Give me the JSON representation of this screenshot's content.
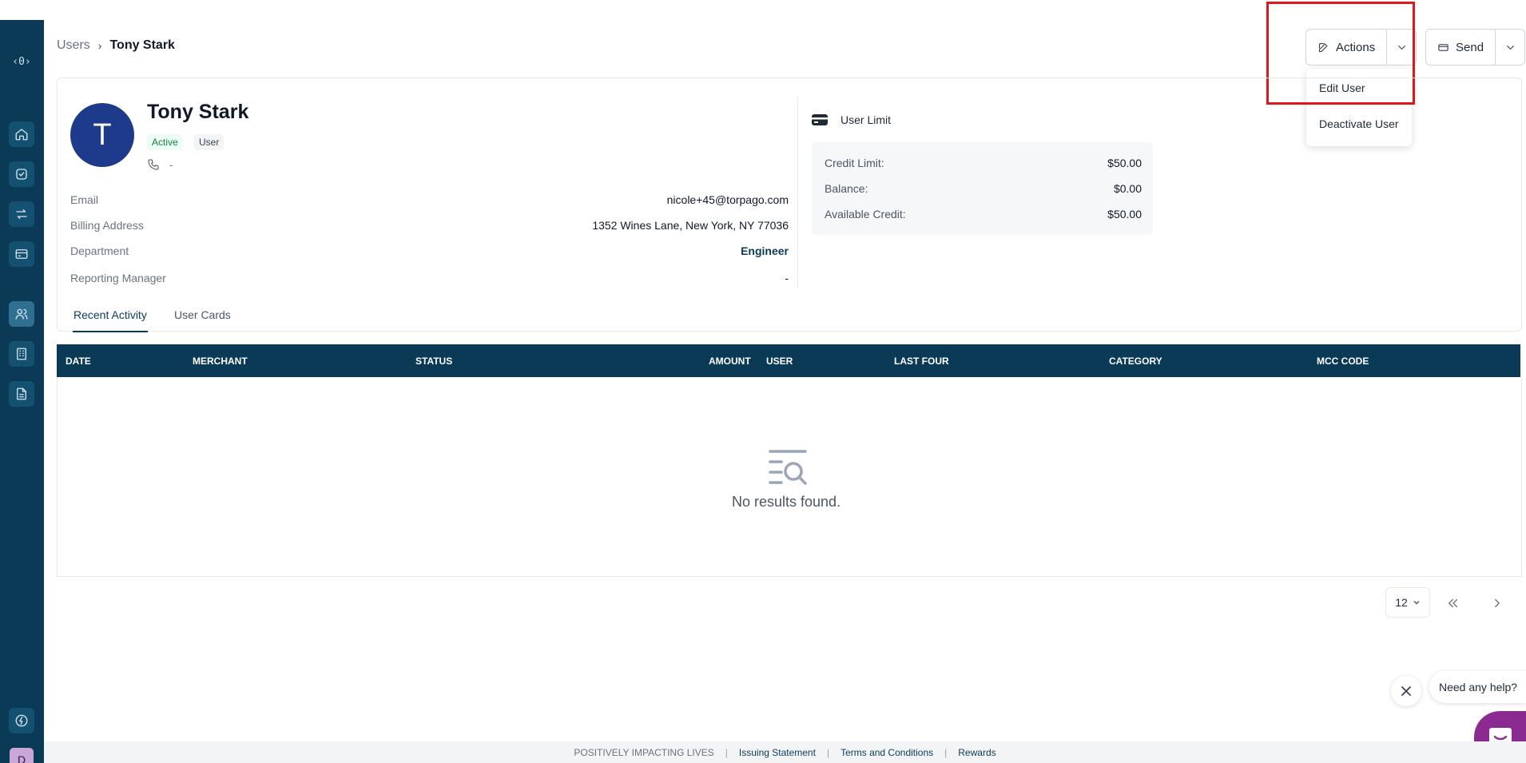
{
  "breadcrumb": {
    "parent": "Users",
    "current": "Tony Stark"
  },
  "header": {
    "actions_label": "Actions",
    "send_label": "Send"
  },
  "actions_menu": {
    "items": [
      "Edit User",
      "Deactivate User"
    ]
  },
  "profile": {
    "initial": "T",
    "name": "Tony Stark",
    "status": "Active",
    "role": "User",
    "phone": "-",
    "fields": [
      {
        "label": "Email",
        "value": "nicole+45@torpago.com"
      },
      {
        "label": "Billing Address",
        "value": "1352 Wines Lane, New York, NY 77036"
      },
      {
        "label": "Department",
        "value": "Engineer"
      },
      {
        "label": "Reporting Manager",
        "value": "-"
      }
    ]
  },
  "user_limit": {
    "title": "User Limit",
    "rows": [
      {
        "label": "Credit Limit:",
        "value": "$50.00"
      },
      {
        "label": "Balance:",
        "value": "$0.00"
      },
      {
        "label": "Available Credit:",
        "value": "$50.00"
      }
    ]
  },
  "tabs": [
    "Recent Activity",
    "User Cards"
  ],
  "table": {
    "columns": [
      "DATE",
      "MERCHANT",
      "STATUS",
      "AMOUNT",
      "USER",
      "LAST FOUR",
      "CATEGORY",
      "MCC CODE"
    ],
    "empty_text": "No results found."
  },
  "pagination": {
    "page_size": "12"
  },
  "help": {
    "bubble_text": "Need any help?"
  },
  "footer": {
    "tagline": "POSITIVELY IMPACTING LIVES",
    "links": [
      "Issuing Statement",
      "Terms and Conditions",
      "Rewards"
    ]
  },
  "sidebar": {
    "logo": "‹0›",
    "avatar_initial": "D"
  },
  "colors": {
    "brand_navy": "#0b3a57",
    "avatar_blue": "#1e3a8a",
    "highlight_red": "#e0161e",
    "help_purple": "#8b2a90"
  }
}
